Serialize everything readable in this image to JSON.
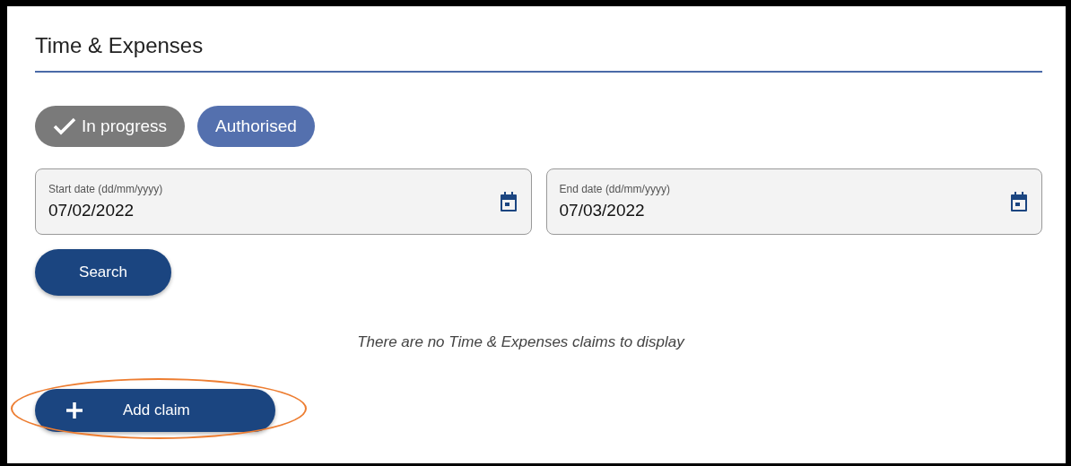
{
  "title": "Time & Expenses",
  "filters": [
    {
      "label": "In progress",
      "selected": true
    },
    {
      "label": "Authorised",
      "selected": false
    }
  ],
  "fields": [
    {
      "label": "Start date (dd/mm/yyyy)",
      "value": "07/02/2022"
    },
    {
      "label": "End date (dd/mm/yyyy)",
      "value": "07/03/2022"
    }
  ],
  "search_button": "Search",
  "empty_message": "There are no Time & Expenses claims to display",
  "add_button": {
    "label": "Add claim",
    "highlighted": true
  }
}
